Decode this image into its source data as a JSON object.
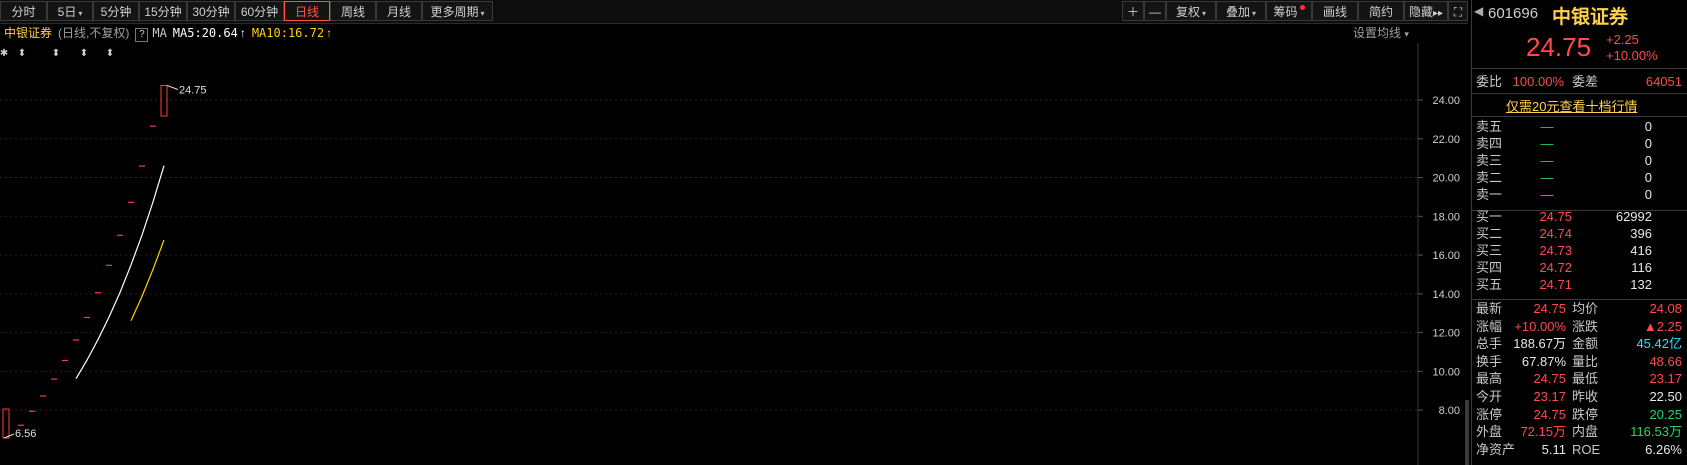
{
  "toolbar": {
    "periods": [
      "分时",
      "5日",
      "5分钟",
      "15分钟",
      "30分钟",
      "60分钟",
      "日线",
      "周线",
      "月线"
    ],
    "more_periods": "更多周期",
    "zoom_in": "＋",
    "zoom_out": "—",
    "restore_rights": "复权",
    "overlay": "叠加",
    "chips": "筹码",
    "draw_line": "画线",
    "simple": "简约",
    "hide": "隐藏",
    "hide_arrows": "▸▸",
    "fullscreen": "⛶"
  },
  "chart_info": {
    "stock_name": "中银证券",
    "period_note": "(日线,不复权)",
    "ma_box": "?",
    "ma_label": "MA",
    "ma5": "MA5:20.64",
    "ma10": "MA10:16.72",
    "up_arrow": "↑",
    "settings": "设置均线",
    "settings_caret": "▾"
  },
  "chart_data": {
    "type": "candlestick",
    "y_axis_ticks": [
      "24.00",
      "22.00",
      "20.00",
      "18.00",
      "16.00",
      "14.00",
      "12.00",
      "10.00",
      "8.00"
    ],
    "ylim": [
      6.2,
      25.6
    ],
    "days": [
      {
        "close": 6.56
      },
      {
        "close": 7.22
      },
      {
        "close": 7.94
      },
      {
        "close": 8.73
      },
      {
        "close": 9.6
      },
      {
        "close": 10.56
      },
      {
        "close": 11.62
      },
      {
        "close": 12.78
      },
      {
        "close": 14.06
      },
      {
        "close": 15.47
      },
      {
        "close": 17.02
      },
      {
        "close": 18.72
      },
      {
        "close": 20.59
      },
      {
        "close": 22.65
      },
      {
        "open": 23.17,
        "high": 24.75,
        "low": 23.17,
        "close": 24.75
      }
    ],
    "max_label": "24.75",
    "min_label": "6.56",
    "top_markers": [
      "✱",
      "⬍",
      "⬍",
      "⬍",
      "⬍"
    ],
    "ma5": [
      9.62,
      10.58,
      11.64,
      12.8,
      14.07,
      15.49,
      17.03,
      18.74,
      20.61
    ],
    "ma10": [
      12.61,
      13.87,
      15.26,
      16.78
    ],
    "colors": {
      "up": "#ff3b3b",
      "ma5": "#ffffff",
      "ma10": "#ffd200",
      "grid": "#3a1a1a",
      "axis": "#cfcfcf"
    }
  },
  "panel": {
    "code": "601696",
    "name": "中银证券",
    "price": "24.75",
    "change": "+2.25",
    "change_pct": "+10.00%",
    "ratio_label": "委比",
    "ratio_value": "100.00%",
    "diff_label": "委差",
    "diff_value": "64051",
    "promo": "仅需20元查看十档行情",
    "asks": [
      {
        "label": "卖五",
        "price": "—",
        "vol": "0"
      },
      {
        "label": "卖四",
        "price": "—",
        "vol": "0"
      },
      {
        "label": "卖三",
        "price": "—",
        "vol": "0"
      },
      {
        "label": "卖二",
        "price": "—",
        "vol": "0"
      },
      {
        "label": "卖一",
        "price": "—",
        "vol": "0"
      }
    ],
    "bids": [
      {
        "label": "买一",
        "price": "24.75",
        "vol": "62992"
      },
      {
        "label": "买二",
        "price": "24.74",
        "vol": "396"
      },
      {
        "label": "买三",
        "price": "24.73",
        "vol": "416"
      },
      {
        "label": "买四",
        "price": "24.72",
        "vol": "116"
      },
      {
        "label": "买五",
        "price": "24.71",
        "vol": "132"
      }
    ],
    "stats": [
      {
        "l1": "最新",
        "v1": "24.75",
        "c1": "red",
        "l2": "均价",
        "v2": "24.08",
        "c2": "red"
      },
      {
        "l1": "涨幅",
        "v1": "+10.00%",
        "c1": "red",
        "l2": "涨跌",
        "v2": "▲2.25",
        "c2": "red"
      },
      {
        "l1": "总手",
        "v1": "188.67万",
        "c1": "white",
        "l2": "金额",
        "v2": "45.42亿",
        "c2": "cyan"
      },
      {
        "l1": "换手",
        "v1": "67.87%",
        "c1": "white",
        "l2": "量比",
        "v2": "48.66",
        "c2": "red"
      },
      {
        "l1": "最高",
        "v1": "24.75",
        "c1": "red",
        "l2": "最低",
        "v2": "23.17",
        "c2": "red"
      },
      {
        "l1": "今开",
        "v1": "23.17",
        "c1": "red",
        "l2": "昨收",
        "v2": "22.50",
        "c2": "white"
      },
      {
        "l1": "涨停",
        "v1": "24.75",
        "c1": "red",
        "l2": "跌停",
        "v2": "20.25",
        "c2": "green"
      },
      {
        "l1": "外盘",
        "v1": "72.15万",
        "c1": "red",
        "l2": "内盘",
        "v2": "116.53万",
        "c2": "green"
      },
      {
        "l1": "净资产",
        "v1": "5.11",
        "c1": "white",
        "l2": "ROE",
        "v2": "6.26%",
        "c2": "white"
      }
    ]
  }
}
